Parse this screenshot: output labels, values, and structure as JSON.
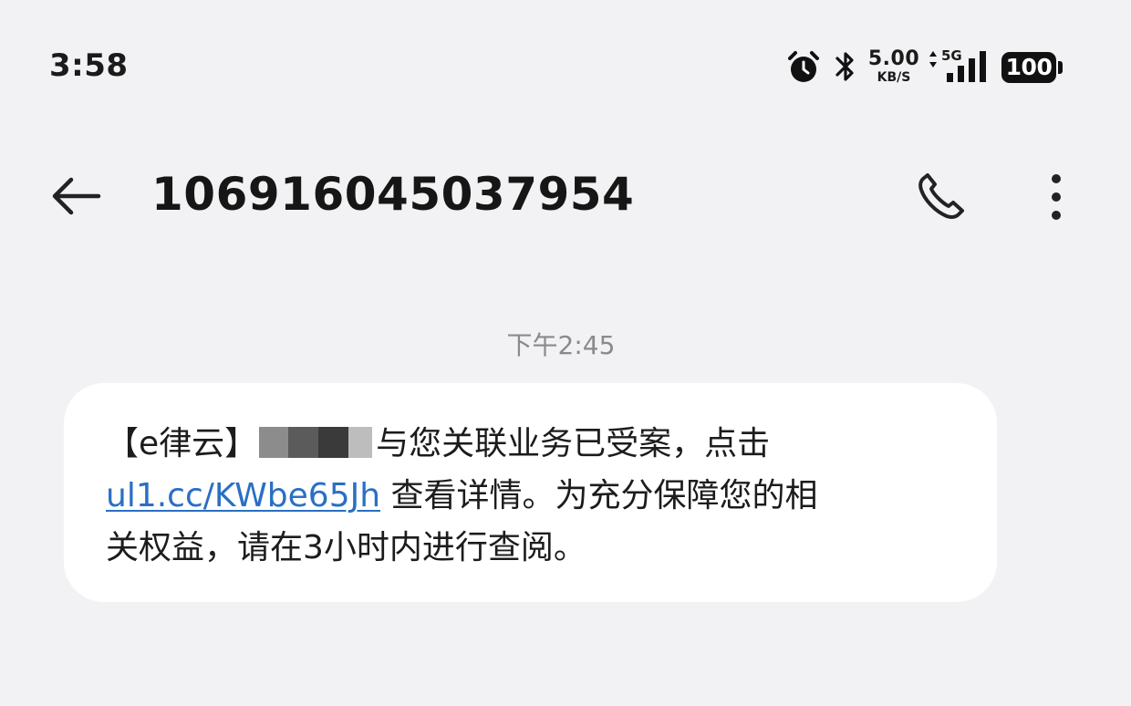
{
  "status_bar": {
    "time": "3:58",
    "alarm_icon": "alarm-clock-icon",
    "bluetooth_icon": "bluetooth-icon",
    "net_speed_value": "5.00",
    "net_speed_unit": "KB/S",
    "network_type": "5G",
    "signal_icon": "cellular-signal-icon",
    "battery_level": "100"
  },
  "header": {
    "back_icon": "back-arrow-icon",
    "title": "106916045037954",
    "call_icon": "phone-icon",
    "more_icon": "more-vertical-icon"
  },
  "conversation": {
    "timestamp": "下午2:45",
    "message": {
      "prefix": "【e律云】",
      "redacted_colors": [
        "#8c8c8c",
        "#5b5b5b",
        "#3a3a3a",
        "#bdbdbd"
      ],
      "line1_rest": "与您关联业务已受案，点击",
      "link": "ul1.cc/KWbe65Jh",
      "line2_rest": " 查看详情。为充分保障您的相",
      "line3": "关权益，请在3小时内进行查阅。"
    }
  },
  "colors": {
    "background": "#f2f2f4",
    "bubble": "#ffffff",
    "link": "#2a6fc4",
    "timestamp": "#8a8a8a"
  }
}
